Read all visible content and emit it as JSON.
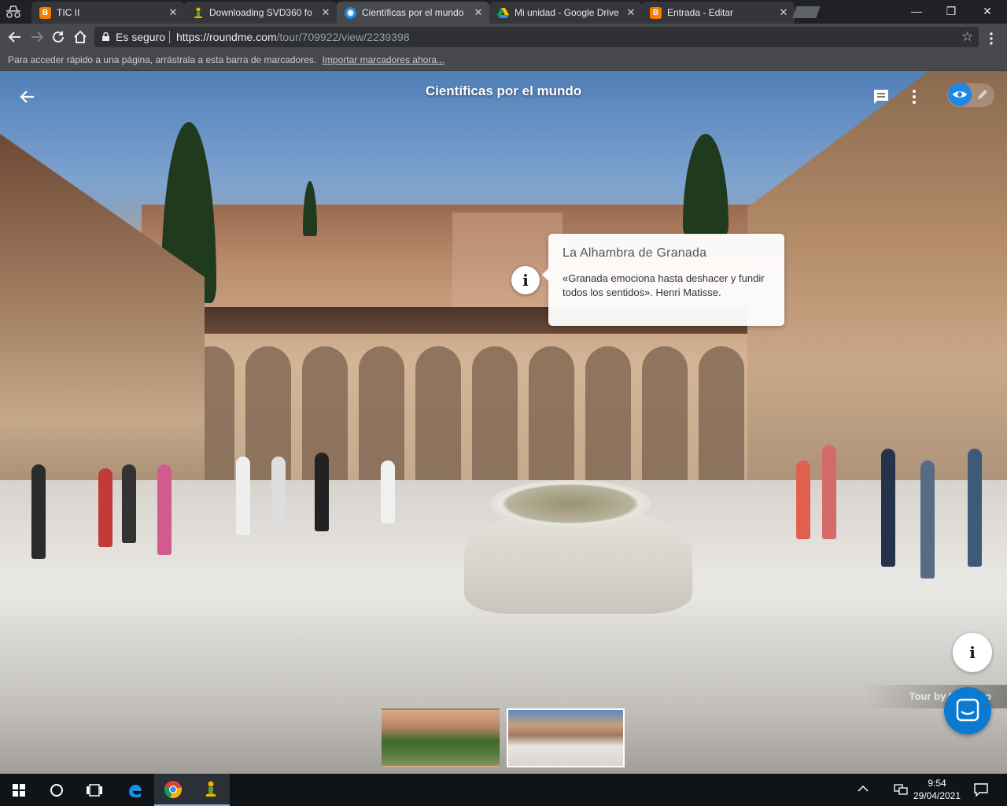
{
  "browser": {
    "tabs": [
      {
        "title": "TIC II",
        "favicon": "blogger-icon",
        "active": false
      },
      {
        "title": "Downloading SVD360 fo",
        "favicon": "download-icon",
        "active": false
      },
      {
        "title": "Científicas por el mundo",
        "favicon": "roundme-icon",
        "active": true
      },
      {
        "title": "Mi unidad - Google Drive",
        "favicon": "drive-icon",
        "active": false
      },
      {
        "title": "Entrada - Editar",
        "favicon": "blogger-icon",
        "active": false
      }
    ],
    "window_controls": {
      "minimize": "—",
      "maximize": "❐",
      "close": "✕"
    },
    "security_label": "Es seguro",
    "url_host": "https://roundme.com",
    "url_path": "/tour/709922/view/2239398",
    "bookmarks_hint": "Para acceder rápido a una página, arrástrala a esta barra de marcadores.",
    "bookmarks_link": "Importar marcadores ahora..."
  },
  "tour": {
    "title": "Científicas por el mundo",
    "hotspot_glyph": "i",
    "popup": {
      "title": "La Alhambra de Granada",
      "body": "«Granada emociona hasta deshacer y fundir todos los sentidos». Henri Matisse."
    },
    "info_glyph": "i",
    "credit": "Tour by No",
    "credit_suffix": "o",
    "scenes": [
      {
        "name": "scene-1",
        "selected": false
      },
      {
        "name": "scene-2",
        "selected": true
      }
    ]
  },
  "taskbar": {
    "time": "9:54",
    "date": "29/04/2021"
  },
  "colors": {
    "accent_blue": "#1e88e5",
    "chat_blue": "#0a7bd1",
    "chrome_dark": "#202124"
  }
}
